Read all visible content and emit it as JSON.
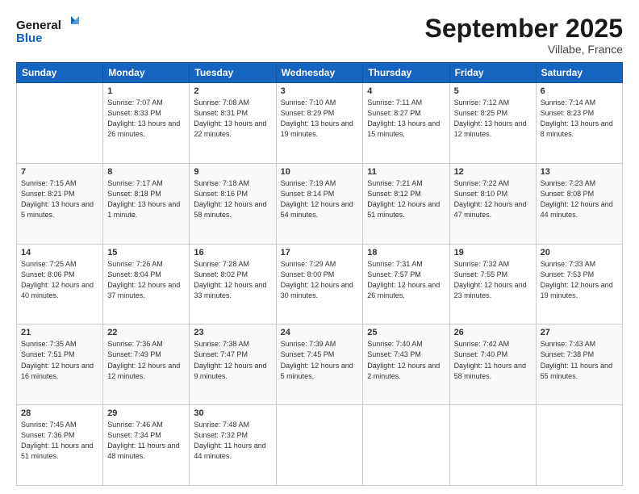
{
  "logo": {
    "line1": "General",
    "line2": "Blue"
  },
  "header": {
    "month": "September 2025",
    "location": "Villabe, France"
  },
  "days_of_week": [
    "Sunday",
    "Monday",
    "Tuesday",
    "Wednesday",
    "Thursday",
    "Friday",
    "Saturday"
  ],
  "weeks": [
    [
      {
        "num": "",
        "sunrise": "",
        "sunset": "",
        "daylight": ""
      },
      {
        "num": "1",
        "sunrise": "Sunrise: 7:07 AM",
        "sunset": "Sunset: 8:33 PM",
        "daylight": "Daylight: 13 hours and 26 minutes."
      },
      {
        "num": "2",
        "sunrise": "Sunrise: 7:08 AM",
        "sunset": "Sunset: 8:31 PM",
        "daylight": "Daylight: 13 hours and 22 minutes."
      },
      {
        "num": "3",
        "sunrise": "Sunrise: 7:10 AM",
        "sunset": "Sunset: 8:29 PM",
        "daylight": "Daylight: 13 hours and 19 minutes."
      },
      {
        "num": "4",
        "sunrise": "Sunrise: 7:11 AM",
        "sunset": "Sunset: 8:27 PM",
        "daylight": "Daylight: 13 hours and 15 minutes."
      },
      {
        "num": "5",
        "sunrise": "Sunrise: 7:12 AM",
        "sunset": "Sunset: 8:25 PM",
        "daylight": "Daylight: 13 hours and 12 minutes."
      },
      {
        "num": "6",
        "sunrise": "Sunrise: 7:14 AM",
        "sunset": "Sunset: 8:23 PM",
        "daylight": "Daylight: 13 hours and 8 minutes."
      }
    ],
    [
      {
        "num": "7",
        "sunrise": "Sunrise: 7:15 AM",
        "sunset": "Sunset: 8:21 PM",
        "daylight": "Daylight: 13 hours and 5 minutes."
      },
      {
        "num": "8",
        "sunrise": "Sunrise: 7:17 AM",
        "sunset": "Sunset: 8:18 PM",
        "daylight": "Daylight: 13 hours and 1 minute."
      },
      {
        "num": "9",
        "sunrise": "Sunrise: 7:18 AM",
        "sunset": "Sunset: 8:16 PM",
        "daylight": "Daylight: 12 hours and 58 minutes."
      },
      {
        "num": "10",
        "sunrise": "Sunrise: 7:19 AM",
        "sunset": "Sunset: 8:14 PM",
        "daylight": "Daylight: 12 hours and 54 minutes."
      },
      {
        "num": "11",
        "sunrise": "Sunrise: 7:21 AM",
        "sunset": "Sunset: 8:12 PM",
        "daylight": "Daylight: 12 hours and 51 minutes."
      },
      {
        "num": "12",
        "sunrise": "Sunrise: 7:22 AM",
        "sunset": "Sunset: 8:10 PM",
        "daylight": "Daylight: 12 hours and 47 minutes."
      },
      {
        "num": "13",
        "sunrise": "Sunrise: 7:23 AM",
        "sunset": "Sunset: 8:08 PM",
        "daylight": "Daylight: 12 hours and 44 minutes."
      }
    ],
    [
      {
        "num": "14",
        "sunrise": "Sunrise: 7:25 AM",
        "sunset": "Sunset: 8:06 PM",
        "daylight": "Daylight: 12 hours and 40 minutes."
      },
      {
        "num": "15",
        "sunrise": "Sunrise: 7:26 AM",
        "sunset": "Sunset: 8:04 PM",
        "daylight": "Daylight: 12 hours and 37 minutes."
      },
      {
        "num": "16",
        "sunrise": "Sunrise: 7:28 AM",
        "sunset": "Sunset: 8:02 PM",
        "daylight": "Daylight: 12 hours and 33 minutes."
      },
      {
        "num": "17",
        "sunrise": "Sunrise: 7:29 AM",
        "sunset": "Sunset: 8:00 PM",
        "daylight": "Daylight: 12 hours and 30 minutes."
      },
      {
        "num": "18",
        "sunrise": "Sunrise: 7:31 AM",
        "sunset": "Sunset: 7:57 PM",
        "daylight": "Daylight: 12 hours and 26 minutes."
      },
      {
        "num": "19",
        "sunrise": "Sunrise: 7:32 AM",
        "sunset": "Sunset: 7:55 PM",
        "daylight": "Daylight: 12 hours and 23 minutes."
      },
      {
        "num": "20",
        "sunrise": "Sunrise: 7:33 AM",
        "sunset": "Sunset: 7:53 PM",
        "daylight": "Daylight: 12 hours and 19 minutes."
      }
    ],
    [
      {
        "num": "21",
        "sunrise": "Sunrise: 7:35 AM",
        "sunset": "Sunset: 7:51 PM",
        "daylight": "Daylight: 12 hours and 16 minutes."
      },
      {
        "num": "22",
        "sunrise": "Sunrise: 7:36 AM",
        "sunset": "Sunset: 7:49 PM",
        "daylight": "Daylight: 12 hours and 12 minutes."
      },
      {
        "num": "23",
        "sunrise": "Sunrise: 7:38 AM",
        "sunset": "Sunset: 7:47 PM",
        "daylight": "Daylight: 12 hours and 9 minutes."
      },
      {
        "num": "24",
        "sunrise": "Sunrise: 7:39 AM",
        "sunset": "Sunset: 7:45 PM",
        "daylight": "Daylight: 12 hours and 5 minutes."
      },
      {
        "num": "25",
        "sunrise": "Sunrise: 7:40 AM",
        "sunset": "Sunset: 7:43 PM",
        "daylight": "Daylight: 12 hours and 2 minutes."
      },
      {
        "num": "26",
        "sunrise": "Sunrise: 7:42 AM",
        "sunset": "Sunset: 7:40 PM",
        "daylight": "Daylight: 11 hours and 58 minutes."
      },
      {
        "num": "27",
        "sunrise": "Sunrise: 7:43 AM",
        "sunset": "Sunset: 7:38 PM",
        "daylight": "Daylight: 11 hours and 55 minutes."
      }
    ],
    [
      {
        "num": "28",
        "sunrise": "Sunrise: 7:45 AM",
        "sunset": "Sunset: 7:36 PM",
        "daylight": "Daylight: 11 hours and 51 minutes."
      },
      {
        "num": "29",
        "sunrise": "Sunrise: 7:46 AM",
        "sunset": "Sunset: 7:34 PM",
        "daylight": "Daylight: 11 hours and 48 minutes."
      },
      {
        "num": "30",
        "sunrise": "Sunrise: 7:48 AM",
        "sunset": "Sunset: 7:32 PM",
        "daylight": "Daylight: 11 hours and 44 minutes."
      },
      {
        "num": "",
        "sunrise": "",
        "sunset": "",
        "daylight": ""
      },
      {
        "num": "",
        "sunrise": "",
        "sunset": "",
        "daylight": ""
      },
      {
        "num": "",
        "sunrise": "",
        "sunset": "",
        "daylight": ""
      },
      {
        "num": "",
        "sunrise": "",
        "sunset": "",
        "daylight": ""
      }
    ]
  ]
}
